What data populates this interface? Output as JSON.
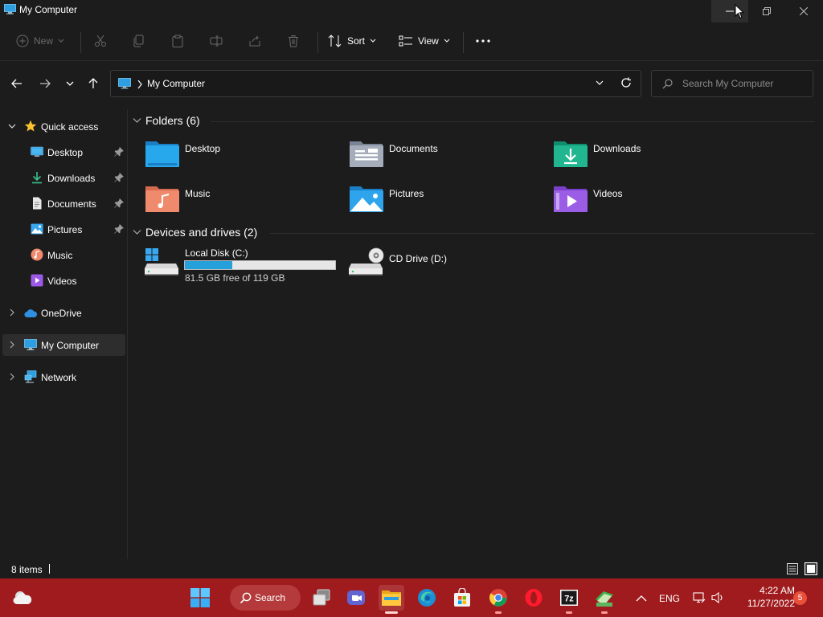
{
  "window": {
    "title": "My Computer"
  },
  "toolbar": {
    "new_label": "New",
    "sort_label": "Sort",
    "view_label": "View"
  },
  "address": {
    "current": "My Computer"
  },
  "search": {
    "placeholder": "Search My Computer"
  },
  "sidebar": {
    "items": [
      {
        "label": "Quick access",
        "icon": "star-icon"
      },
      {
        "label": "Desktop",
        "icon": "desktop-icon",
        "pinned": true
      },
      {
        "label": "Downloads",
        "icon": "download-icon",
        "pinned": true
      },
      {
        "label": "Documents",
        "icon": "document-icon",
        "pinned": true
      },
      {
        "label": "Pictures",
        "icon": "pictures-icon",
        "pinned": true
      },
      {
        "label": "Music",
        "icon": "music-icon"
      },
      {
        "label": "Videos",
        "icon": "videos-icon"
      },
      {
        "label": "OneDrive",
        "icon": "cloud-icon"
      },
      {
        "label": "My Computer",
        "icon": "computer-icon",
        "selected": true
      },
      {
        "label": "Network",
        "icon": "network-icon"
      }
    ]
  },
  "content": {
    "folders_header": "Folders (6)",
    "folders": [
      {
        "label": "Desktop",
        "icon": "desktop-folder-icon"
      },
      {
        "label": "Documents",
        "icon": "documents-folder-icon"
      },
      {
        "label": "Downloads",
        "icon": "downloads-folder-icon"
      },
      {
        "label": "Music",
        "icon": "music-folder-icon"
      },
      {
        "label": "Pictures",
        "icon": "pictures-folder-icon"
      },
      {
        "label": "Videos",
        "icon": "videos-folder-icon"
      }
    ],
    "drives_header": "Devices and drives (2)",
    "drives": [
      {
        "label": "Local Disk (C:)",
        "free_text": "81.5 GB free of 119 GB",
        "used_fraction": 0.315,
        "icon": "hard-drive-icon"
      },
      {
        "label": "CD Drive (D:)",
        "icon": "cd-drive-icon"
      }
    ]
  },
  "status": {
    "item_count": "8 items"
  },
  "taskbar": {
    "search_label": "Search",
    "language": "ENG",
    "time": "4:22 AM",
    "date": "11/27/2022",
    "notifications": "5",
    "accent_color": "#a01b1d"
  }
}
